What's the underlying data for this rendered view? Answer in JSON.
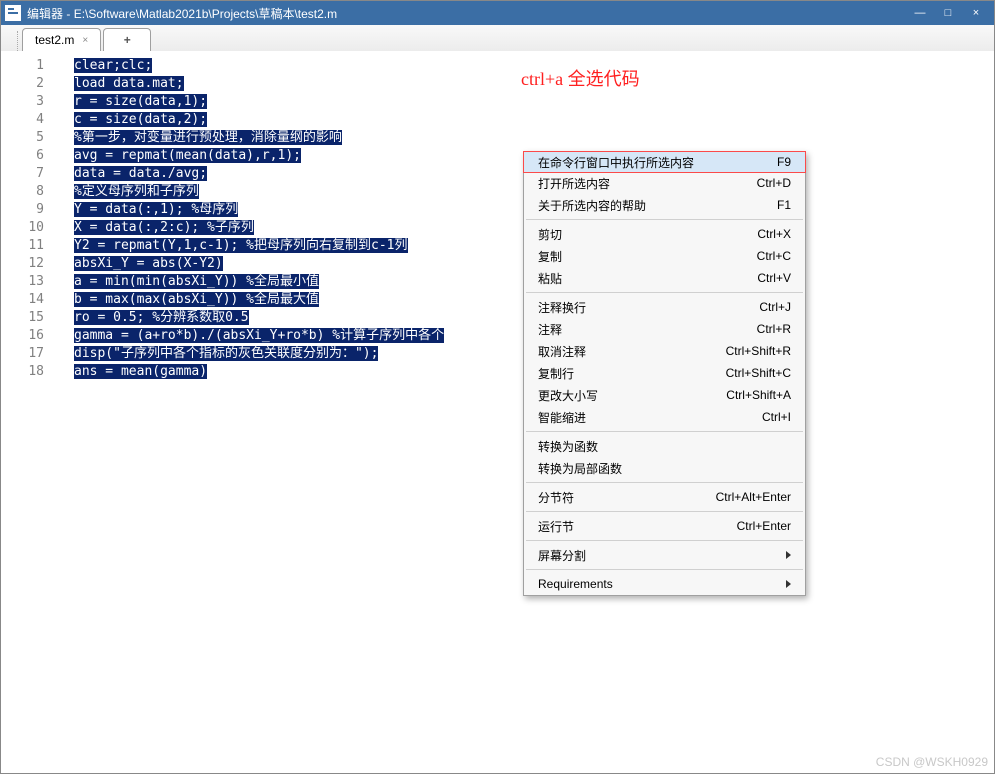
{
  "titlebar": {
    "appname": "编辑器",
    "path": "E:\\Software\\Matlab2021b\\Projects\\草稿本\\test2.m",
    "min": "—",
    "max": "□",
    "close": "×"
  },
  "tabs": {
    "file": "test2.m",
    "plus": "+"
  },
  "line_numbers": [
    "1",
    "2",
    "3",
    "4",
    "5",
    "6",
    "7",
    "8",
    "9",
    "10",
    "11",
    "12",
    "13",
    "14",
    "15",
    "16",
    "17",
    "18"
  ],
  "code_lines": [
    "clear;clc;",
    "load data.mat;",
    "r = size(data,1);",
    "c = size(data,2);",
    "%第一步，对变量进行预处理，消除量纲的影响",
    "avg = repmat(mean(data),r,1);",
    "data = data./avg;",
    "%定义母序列和子序列",
    "Y = data(:,1); %母序列",
    "X = data(:,2:c); %子序列",
    "Y2 = repmat(Y,1,c-1); %把母序列向右复制到c-1列",
    "absXi_Y = abs(X-Y2)",
    "a = min(min(absXi_Y)) %全局最小值",
    "b = max(max(absXi_Y)) %全局最大值",
    "ro = 0.5; %分辨系数取0.5",
    "gamma = (a+ro*b)./(absXi_Y+ro*b) %计算子序列中各个",
    "disp(\"子序列中各个指标的灰色关联度分别为：\");",
    "ans = mean(gamma)"
  ],
  "annotation": "ctrl+a 全选代码",
  "context_menu": {
    "groups": [
      [
        {
          "label": "在命令行窗口中执行所选内容",
          "shortcut": "F9",
          "highlight": true
        },
        {
          "label": "打开所选内容",
          "shortcut": "Ctrl+D"
        },
        {
          "label": "关于所选内容的帮助",
          "shortcut": "F1"
        }
      ],
      [
        {
          "label": "剪切",
          "shortcut": "Ctrl+X"
        },
        {
          "label": "复制",
          "shortcut": "Ctrl+C"
        },
        {
          "label": "粘贴",
          "shortcut": "Ctrl+V"
        }
      ],
      [
        {
          "label": "注释换行",
          "shortcut": "Ctrl+J"
        },
        {
          "label": "注释",
          "shortcut": "Ctrl+R"
        },
        {
          "label": "取消注释",
          "shortcut": "Ctrl+Shift+R"
        },
        {
          "label": "复制行",
          "shortcut": "Ctrl+Shift+C"
        },
        {
          "label": "更改大小写",
          "shortcut": "Ctrl+Shift+A"
        },
        {
          "label": "智能缩进",
          "shortcut": "Ctrl+I"
        }
      ],
      [
        {
          "label": "转换为函数",
          "shortcut": ""
        },
        {
          "label": "转换为局部函数",
          "shortcut": ""
        }
      ],
      [
        {
          "label": "分节符",
          "shortcut": "Ctrl+Alt+Enter"
        }
      ],
      [
        {
          "label": "运行节",
          "shortcut": "Ctrl+Enter"
        }
      ],
      [
        {
          "label": "屏幕分割",
          "shortcut": "",
          "submenu": true
        }
      ],
      [
        {
          "label": "Requirements",
          "shortcut": "",
          "submenu": true
        }
      ]
    ]
  },
  "watermark": "CSDN @WSKH0929"
}
